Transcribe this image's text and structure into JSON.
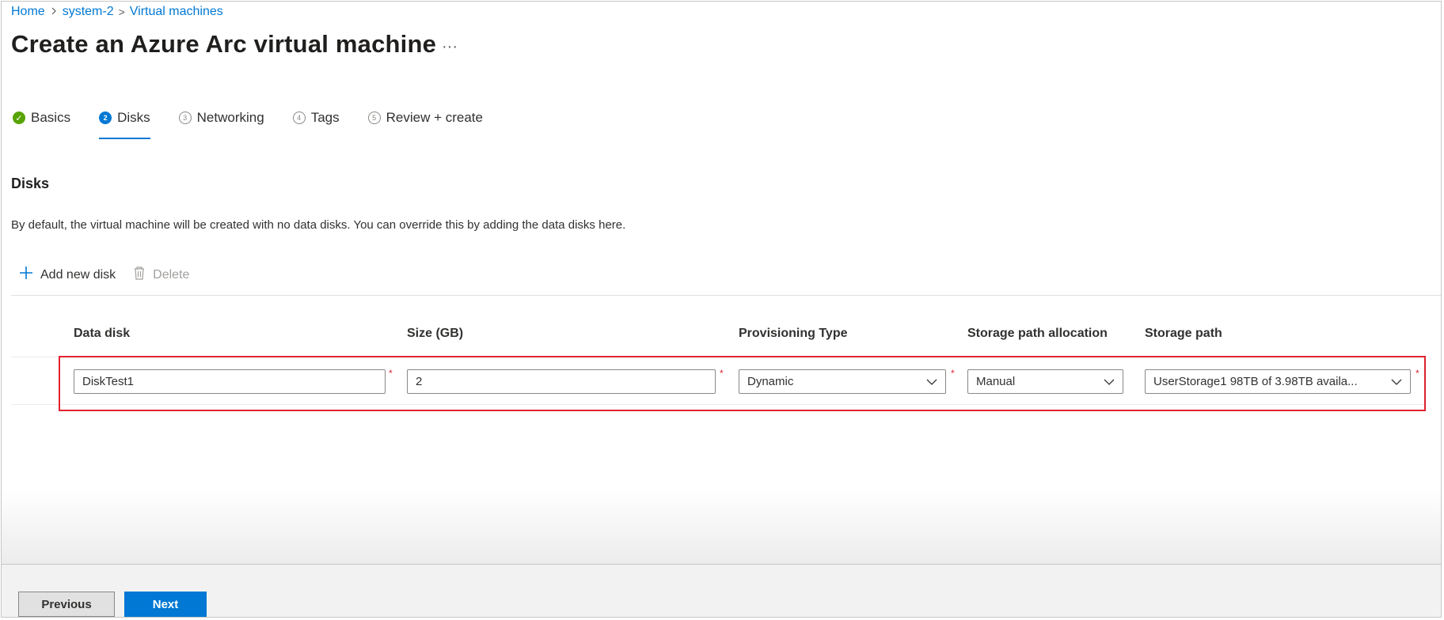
{
  "breadcrumb": {
    "home": "Home",
    "separator": ">",
    "system": "system-2",
    "virtual_machines": "Virtual machines"
  },
  "page": {
    "title": "Create an Azure Arc virtual machine",
    "more": "···"
  },
  "tabs": [
    {
      "label": "Basics",
      "step": "✓",
      "state": "completed"
    },
    {
      "label": "Disks",
      "step": "2",
      "state": "active"
    },
    {
      "label": "Networking",
      "step": "3",
      "state": "pending"
    },
    {
      "label": "Tags",
      "step": "4",
      "state": "pending"
    },
    {
      "label": "Review + create",
      "step": "5",
      "state": "pending"
    }
  ],
  "section": {
    "title": "Disks",
    "description": "By default, the virtual machine will be created with no data disks. You can override this by adding the data disks here."
  },
  "toolbar": {
    "add_label": "Add new disk",
    "delete_label": "Delete",
    "add_icon": "plus-icon",
    "delete_icon": "trash-icon"
  },
  "table": {
    "headers": [
      "Data disk",
      "Size (GB)",
      "Provisioning Type",
      "Storage path allocation",
      "Storage path"
    ],
    "row": {
      "data_disk": "DiskTest1",
      "size": "2",
      "provisioning_type": "Dynamic",
      "allocation": "Manual",
      "storage_path": "UserStorage1 98TB of 3.98TB availa..."
    },
    "required_mark": "*"
  },
  "footer": {
    "previous": "Previous",
    "next": "Next"
  },
  "colors": {
    "accent": "#0078d4",
    "success": "#57a300",
    "highlight": "#e0232e"
  }
}
